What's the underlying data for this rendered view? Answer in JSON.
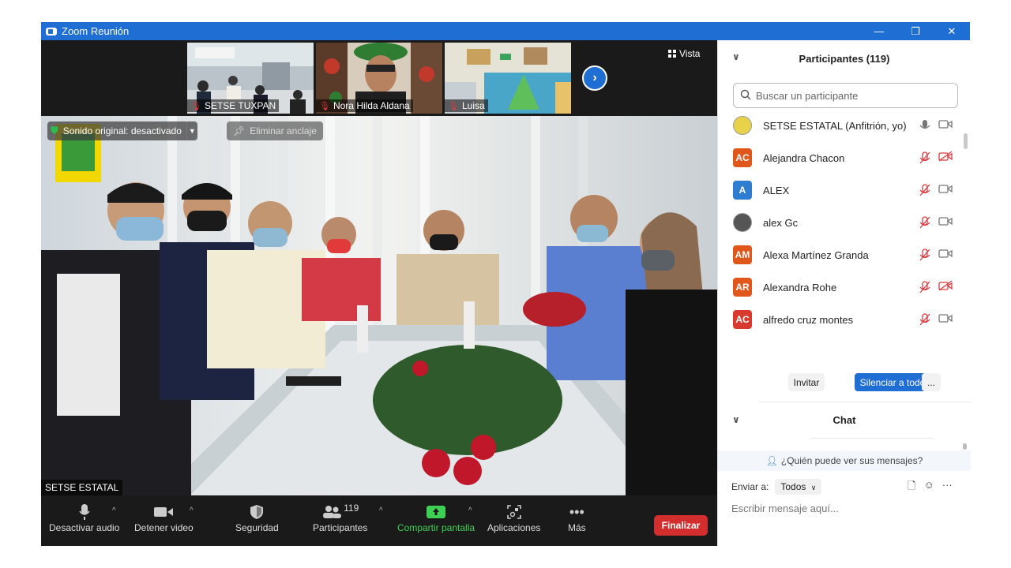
{
  "window": {
    "title": "Zoom Reunión",
    "minimize": "—",
    "restore": "❐",
    "close": "✕"
  },
  "thumbnails": [
    {
      "name": "SETSE TUXPAN"
    },
    {
      "name": "Nora Hilda Aldana"
    },
    {
      "name": "Luisa"
    }
  ],
  "view": {
    "label": "Vista"
  },
  "main_video": {
    "sound_label": "Sonido original: desactivado",
    "unpin_label": "Eliminar anclaje",
    "speaker": "SETSE ESTATAL"
  },
  "toolbar": {
    "audio": "Desactivar audio",
    "video": "Detener video",
    "security": "Seguridad",
    "participants": "Participantes",
    "participants_count": "119",
    "share": "Compartir pantalla",
    "apps": "Aplicaciones",
    "more": "Más",
    "end": "Finalizar"
  },
  "panel": {
    "title": "Participantes (119)",
    "search_placeholder": "Buscar un participante",
    "participants": [
      {
        "name": "SETSE ESTATAL (Anfitrión, yo)",
        "initials": "",
        "avatar_color": "#e8d24a",
        "mic": "on",
        "cam": "on"
      },
      {
        "name": "Alejandra Chacon",
        "initials": "AC",
        "avatar_color": "#e0571c",
        "mic": "muted",
        "cam": "off"
      },
      {
        "name": "ALEX",
        "initials": "A",
        "avatar_color": "#2f7dd1",
        "mic": "muted",
        "cam": "on"
      },
      {
        "name": "alex Gc",
        "initials": "",
        "avatar_color": "#555555",
        "mic": "muted",
        "cam": "on"
      },
      {
        "name": "Alexa Martínez Granda",
        "initials": "AM",
        "avatar_color": "#e0571c",
        "mic": "muted",
        "cam": "on"
      },
      {
        "name": "Alexandra Rohe",
        "initials": "AR",
        "avatar_color": "#e0571c",
        "mic": "muted",
        "cam": "off"
      },
      {
        "name": "alfredo cruz montes",
        "initials": "AC",
        "avatar_color": "#d83b2e",
        "mic": "muted",
        "cam": "on"
      }
    ],
    "invite": "Invitar",
    "mute_all": "Silenciar a todos",
    "more": "...",
    "chat_title": "Chat",
    "who_sees": "¿Quién puede ver sus mensajes?",
    "send_to_label": "Enviar a:",
    "send_to_value": "Todos",
    "chat_placeholder": "Escribir mensaje aquí..."
  },
  "colors": {
    "accent": "#1f6ed4",
    "end": "#d32e2e",
    "share": "#3ecf55",
    "muted": "#e0393e"
  }
}
